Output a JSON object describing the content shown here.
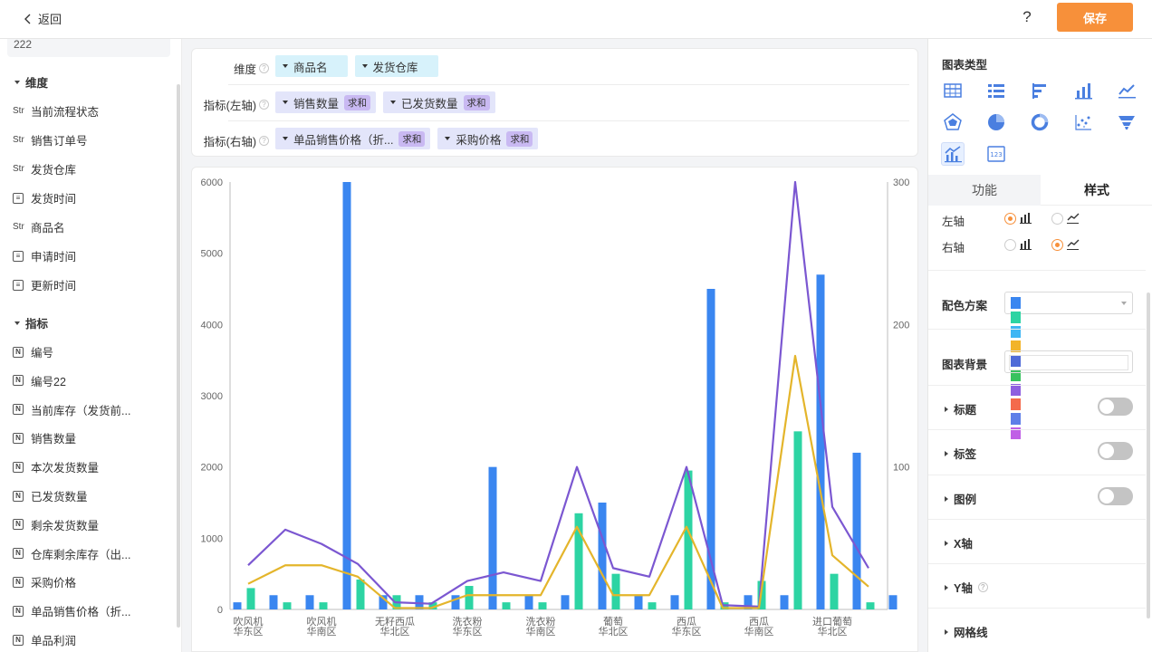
{
  "topbar": {
    "back_label": "返回",
    "help": "?",
    "save_label": "保存"
  },
  "left": {
    "top_item": "222",
    "dim_title": "维度",
    "dims": [
      {
        "type": "Str",
        "label": "当前流程状态"
      },
      {
        "type": "Str",
        "label": "销售订单号"
      },
      {
        "type": "Str",
        "label": "发货仓库"
      },
      {
        "type": "date",
        "label": "发货时间"
      },
      {
        "type": "Str",
        "label": "商品名"
      },
      {
        "type": "date",
        "label": "申请时间"
      },
      {
        "type": "date",
        "label": "更新时间"
      }
    ],
    "metric_title": "指标",
    "metrics": [
      {
        "type": "N",
        "label": "编号"
      },
      {
        "type": "N",
        "label": "编号22"
      },
      {
        "type": "N",
        "label": "当前库存（发货前..."
      },
      {
        "type": "N",
        "label": "销售数量"
      },
      {
        "type": "N",
        "label": "本次发货数量"
      },
      {
        "type": "N",
        "label": "已发货数量"
      },
      {
        "type": "N",
        "label": "剩余发货数量"
      },
      {
        "type": "N",
        "label": "仓库剩余库存（出..."
      },
      {
        "type": "N",
        "label": "采购价格"
      },
      {
        "type": "N",
        "label": "单品销售价格（折..."
      },
      {
        "type": "N",
        "label": "单品利润"
      }
    ]
  },
  "config": {
    "dimension_label": "维度",
    "left_axis_label": "指标(左轴)",
    "right_axis_label": "指标(右轴)",
    "dimensions": [
      "商品名",
      "发货仓库"
    ],
    "left_metrics": [
      {
        "name": "销售数量",
        "agg": "求和"
      },
      {
        "name": "已发货数量",
        "agg": "求和"
      }
    ],
    "right_metrics": [
      {
        "name": "单品销售价格（折...",
        "agg": "求和"
      },
      {
        "name": "采购价格",
        "agg": "求和"
      }
    ]
  },
  "right": {
    "chart_type_title": "图表类型",
    "chart_types": [
      "table-icon",
      "list-icon",
      "bar-horizontal-icon",
      "bar-chart-icon",
      "line-chart-icon",
      "radar-icon",
      "pie-icon",
      "donut-icon",
      "scatter-icon",
      "funnel-icon",
      "combo-chart-icon",
      "number-card-icon"
    ],
    "selected_type": "combo-chart-icon",
    "tab_function": "功能",
    "tab_style": "样式",
    "left_axis": "左轴",
    "right_axis": "右轴",
    "color_scheme_label": "配色方案",
    "palette": [
      "#3a86f0",
      "#2dd4a3",
      "#3fb6f4",
      "#f2b429",
      "#4f6ad8",
      "#38c25f",
      "#8e5fe0",
      "#f46a4c",
      "#5f7fe8",
      "#c060e6"
    ],
    "chart_bg_label": "图表背景",
    "sections": [
      {
        "label": "标题",
        "toggle": false
      },
      {
        "label": "标签",
        "toggle": false
      },
      {
        "label": "图例",
        "toggle": false
      },
      {
        "label": "X轴"
      },
      {
        "label": "Y轴",
        "help": true
      },
      {
        "label": "网格线"
      }
    ]
  },
  "chart_data": {
    "type": "bar+line",
    "x_labels": [
      [
        "吹风机",
        "华东区"
      ],
      [
        "吹风机",
        "华南区"
      ],
      [
        "无籽西瓜",
        "华北区"
      ],
      [
        "洗衣粉",
        "华东区"
      ],
      [
        "洗衣粉",
        "华南区"
      ],
      [
        "葡萄",
        "华北区"
      ],
      [
        "西瓜",
        "华东区"
      ],
      [
        "西瓜",
        "华南区"
      ],
      [
        "进口葡萄",
        "华北区"
      ]
    ],
    "left_axis": {
      "ylim": [
        0,
        6000
      ],
      "ticks": [
        0,
        1000,
        2000,
        3000,
        4000,
        5000,
        6000
      ]
    },
    "right_axis": {
      "ylim": [
        0,
        300
      ],
      "ticks": [
        100,
        200,
        300
      ]
    },
    "bar_series": [
      {
        "name": "销售数量",
        "color": "#3a86f0",
        "values": [
          100,
          200,
          200,
          6000,
          200,
          200,
          200,
          2000,
          200,
          200,
          1500,
          200,
          200,
          4500,
          200,
          200,
          4700,
          2200,
          200
        ]
      },
      {
        "name": "已发货数量",
        "color": "#2dd4a3",
        "values": [
          300,
          100,
          100,
          420,
          200,
          100,
          330,
          100,
          100,
          1350,
          500,
          100,
          1950,
          100,
          400,
          2500,
          500,
          100
        ]
      }
    ],
    "line_series": [
      {
        "name": "单品销售价格（折...",
        "color": "#7b57d1",
        "values": [
          31,
          56,
          46,
          32,
          5,
          4,
          20,
          26,
          20,
          100,
          29,
          23,
          100,
          3,
          2,
          300,
          72,
          29
        ]
      },
      {
        "name": "采购价格",
        "color": "#e4b52b",
        "values": [
          18,
          31,
          31,
          23,
          1,
          1,
          10,
          10,
          10,
          58,
          10,
          10,
          58,
          1,
          1,
          178,
          38,
          16
        ]
      }
    ]
  }
}
